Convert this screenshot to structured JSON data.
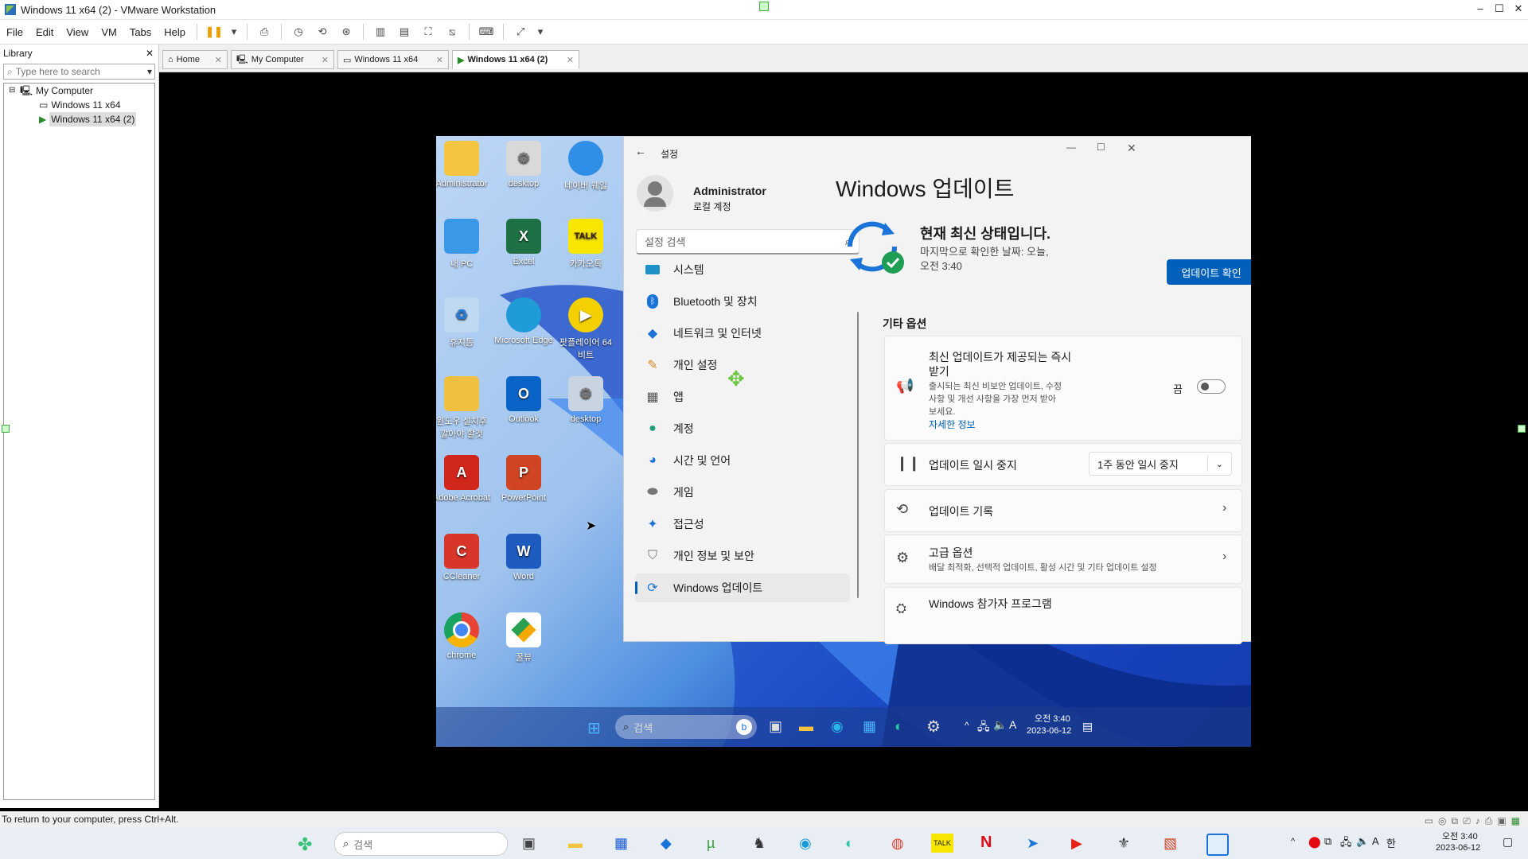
{
  "window": {
    "title": "Windows 11 x64 (2) - VMware Workstation"
  },
  "menu": [
    "File",
    "Edit",
    "View",
    "VM",
    "Tabs",
    "Help"
  ],
  "library": {
    "title": "Library",
    "search_placeholder": "Type here to search",
    "tree": [
      {
        "label": "My Computer"
      },
      {
        "label": "Windows 11 x64"
      },
      {
        "label": "Windows 11 x64 (2)"
      }
    ]
  },
  "tabs": [
    {
      "label": "Home"
    },
    {
      "label": "My Computer"
    },
    {
      "label": "Windows 11 x64"
    },
    {
      "label": "Windows 11 x64 (2)"
    }
  ],
  "status": {
    "text": "To return to your computer, press Ctrl+Alt."
  },
  "host_taskbar": {
    "search": "검색",
    "time": "오전 3:40",
    "date": "2023-06-12"
  },
  "desktop_icons": [
    {
      "label": "Administrator",
      "color": "#f5c542"
    },
    {
      "label": "desktop",
      "color": "#d9d9d9"
    },
    {
      "label": "네이버 웨일",
      "color": "#2f8ee6"
    },
    {
      "label": "내 PC",
      "color": "#3a98e8"
    },
    {
      "label": "Excel",
      "color": "#1e7145"
    },
    {
      "label": "카카오톡",
      "color": "#f7e600"
    },
    {
      "label": "휴지통",
      "color": "#bfd9f2"
    },
    {
      "label": "Microsoft Edge",
      "color": "#1f9bd8"
    },
    {
      "label": "팟플레이어 64 비트",
      "color": "#f5d000"
    },
    {
      "label": "윈도우 설치후 깔아야 할것",
      "color": "#f0c040"
    },
    {
      "label": "Outlook",
      "color": "#0a64c8"
    },
    {
      "label": "desktop",
      "color": "#c9d4e2"
    },
    {
      "label": "Adobe Acrobat",
      "color": "#d1261c"
    },
    {
      "label": "PowerPoint",
      "color": "#d04423"
    },
    {
      "label": "CCleaner",
      "color": "#d9362b"
    },
    {
      "label": "Word",
      "color": "#1e5bbf"
    },
    {
      "label": "chrome",
      "color": "#e84335"
    },
    {
      "label": "꿀뷰",
      "color": "#ffffff"
    }
  ],
  "settings": {
    "title": "설정",
    "user_name": "Administrator",
    "user_type": "로컬 계정",
    "search_placeholder": "설정 검색",
    "nav": [
      {
        "label": "시스템",
        "icon": "monitor-icon"
      },
      {
        "label": "Bluetooth 및 장치",
        "icon": "bluetooth-icon"
      },
      {
        "label": "네트워크 및 인터넷",
        "icon": "wifi-icon"
      },
      {
        "label": "개인 설정",
        "icon": "brush-icon"
      },
      {
        "label": "앱",
        "icon": "apps-icon"
      },
      {
        "label": "계정",
        "icon": "person-icon"
      },
      {
        "label": "시간 및 언어",
        "icon": "globe-icon"
      },
      {
        "label": "게임",
        "icon": "gamepad-icon"
      },
      {
        "label": "접근성",
        "icon": "accessibility-icon"
      },
      {
        "label": "개인 정보 및 보안",
        "icon": "shield-icon"
      },
      {
        "label": "Windows 업데이트",
        "icon": "update-icon"
      }
    ],
    "page_title": "Windows 업데이트",
    "status_title": "현재 최신 상태입니다.",
    "status_sub": "마지막으로 확인한 날짜: 오늘,",
    "status_sub2": "오전 3:40",
    "check_button": "업데이트 확인",
    "more_options": "기타 옵션",
    "latest_title": "최신 업데이트가 제공되는 즉시",
    "latest_title2": "받기",
    "latest_desc": "출시되는 최신 비보안 업데이트, 수정",
    "latest_desc2": "사항 및 개선 사항을 가장 먼저 받아",
    "latest_desc3": "보세요.",
    "learn_more": "자세한 정보",
    "toggle_label": "끔",
    "pause_title": "업데이트 일시 중지",
    "pause_value": "1주 동안 일시 중지",
    "history_title": "업데이트 기록",
    "advanced_title": "고급 옵션",
    "advanced_desc": "배달 최적화, 선택적 업데이트, 활성 시간 및 기타 업데이트 설정",
    "insider_title": "Windows 참가자 프로그램"
  },
  "vm_taskbar": {
    "search": "검색",
    "time": "오전 3:40",
    "date": "2023-06-12"
  },
  "colors": {
    "accent": "#005fb8",
    "active_tab": "#ffffff",
    "toggle_off": "#8a8a8a"
  }
}
